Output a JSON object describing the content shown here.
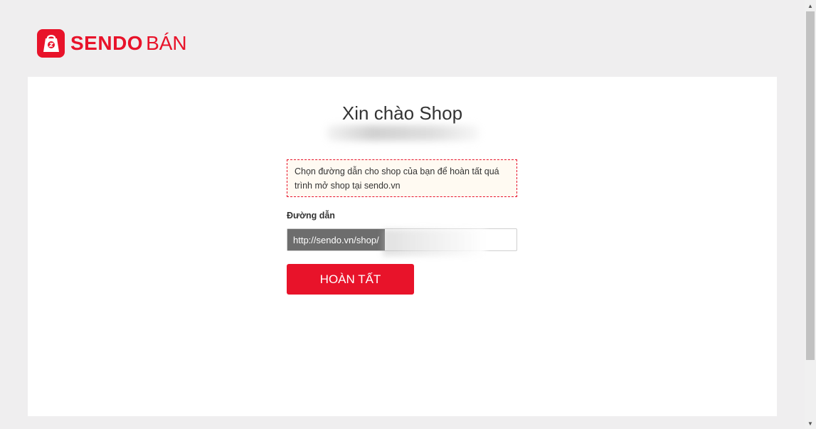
{
  "brand": {
    "logo_text": "SENDO",
    "logo_sub": "BÁN",
    "accent_color": "#e8132a"
  },
  "main": {
    "greeting": "Xin chào Shop",
    "notice": "Chọn đường dẫn cho shop của bạn để hoàn tất quá trình mở shop tại sendo.vn",
    "field_label": "Đường dẫn",
    "url_prefix": "http://sendo.vn/shop/",
    "url_value": "",
    "submit_label": "HOÀN TẤT"
  },
  "icons": {
    "logo": "sendo-bag-icon",
    "scroll_up": "triangle-up",
    "scroll_down": "triangle-down"
  }
}
